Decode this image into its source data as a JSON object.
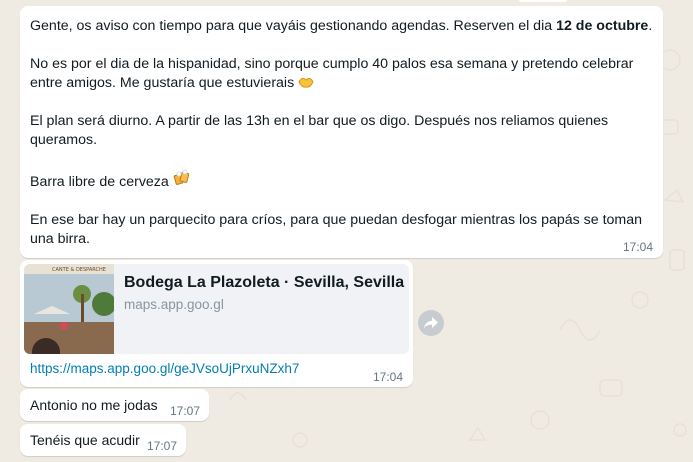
{
  "messages": {
    "main": {
      "line1_pre": "Gente, os aviso con tiempo para que vayáis gestionando agendas. Reserven el dia ",
      "line1_bold": "12 de octubre",
      "line1_post": ".",
      "para2": "No es por el dia de la hispanidad, sino porque cumplo 40 palos esa semana y pretendo celebrar entre amigos. Me gustaría que estuvierais",
      "para3": "El plan será diurno. A partir de las 13h en el bar que os digo. Después nos reliamos quienes queramos.",
      "para4": "Barra libre de cerveza",
      "para5": "En ese bar hay un parquecito para críos, para que puedan desfogar mientras los papás se toman una birra.",
      "time": "17:04",
      "emoji1": "hugging-hands-emoji",
      "emoji2": "beer-mugs-emoji"
    },
    "link": {
      "preview_title": "Bodega La Plazoleta · Sevilla, Sevilla",
      "preview_domain": "maps.app.goo.gl",
      "thumb_sign": "CANTE & DESPARCHE",
      "url": "https://maps.app.goo.gl/geJVsoUjPrxuNZxh7",
      "time": "17:04"
    },
    "reply1": {
      "text": "Antonio no me jodas",
      "time": "17:07"
    },
    "reply2": {
      "text": "Tenéis que acudir",
      "time": "17:07"
    }
  },
  "colors": {
    "chat_background": "#efeae2",
    "bubble": "#ffffff",
    "link": "#027eb5",
    "timestamp": "#667781"
  }
}
